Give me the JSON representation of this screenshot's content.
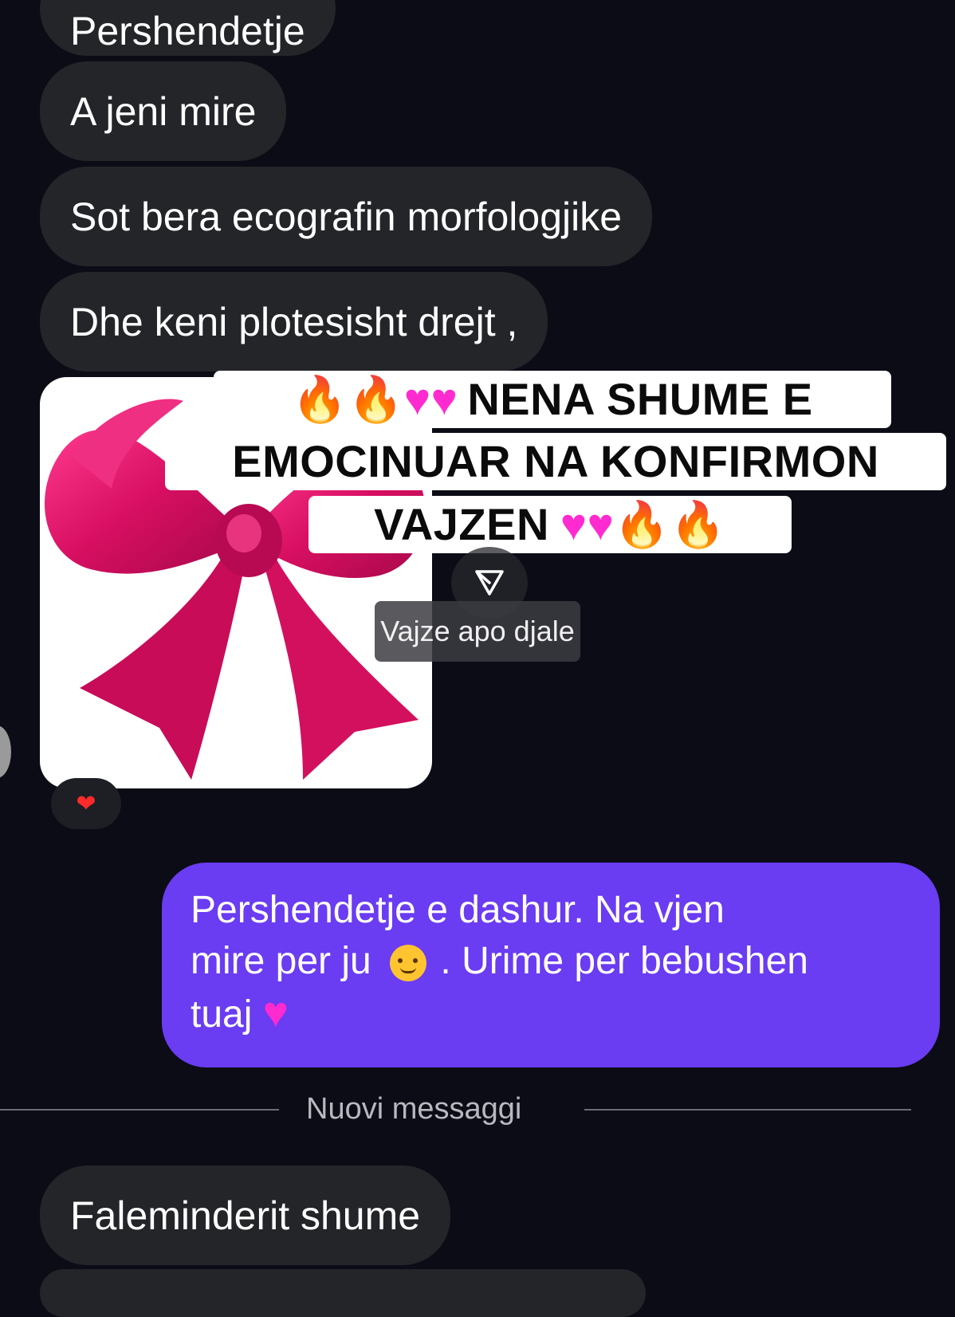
{
  "messages_in": [
    {
      "text": "Pershendetje"
    },
    {
      "text": "A jeni mire"
    },
    {
      "text": "Sot bera ecografin morfologjike"
    },
    {
      "text": "Dhe keni plotesisht drejt ,"
    }
  ],
  "shared_post": {
    "banner": {
      "line1": "NENA SHUME E",
      "line2": "EMOCINUAR NA KONFIRMON",
      "line3": "VAJZEN"
    },
    "caption": "Vajze apo djale",
    "image_icon": "pink-bow-image"
  },
  "reaction": {
    "icon": "red-heart-icon"
  },
  "message_out": {
    "line1": "Pershendetje e dashur. Na vjen",
    "line2_a": "mire per ju",
    "line2_b": ". Urime per bebushen",
    "line3": "tuaj"
  },
  "divider": {
    "label": "Nuovi messaggi"
  },
  "last_message": {
    "text": "Faleminderit shume"
  },
  "colors": {
    "background": "#0b0c16",
    "incoming_bubble": "#232529",
    "outgoing_bubble": "#6a3cf2",
    "bow": "#e3126a",
    "heart_pink": "#ff2bd0"
  }
}
